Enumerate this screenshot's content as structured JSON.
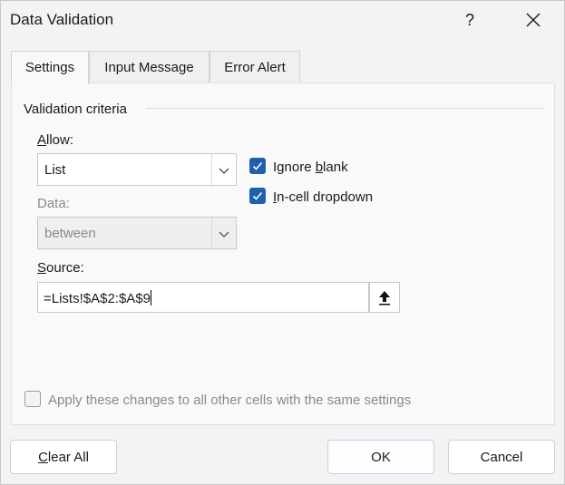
{
  "window": {
    "title": "Data Validation",
    "help_label": "?",
    "close_icon": "close-icon"
  },
  "tabs": [
    {
      "label": "Settings",
      "active": true
    },
    {
      "label": "Input Message",
      "active": false
    },
    {
      "label": "Error Alert",
      "active": false
    }
  ],
  "criteria": {
    "group_label": "Validation criteria",
    "allow": {
      "label_access": "A",
      "label_rest": "llow:",
      "value": "List"
    },
    "data": {
      "label": "Data:",
      "value": "between",
      "disabled": true
    },
    "ignore_blank": {
      "label_pre": "Ignore ",
      "label_access": "b",
      "label_post": "lank",
      "checked": true
    },
    "in_cell_dropdown": {
      "label_access": "I",
      "label_rest": "n-cell dropdown",
      "checked": true
    },
    "source": {
      "label_access": "S",
      "label_rest": "ource:",
      "value": "=Lists!$A$2:$A$9",
      "collapse_icon": "collapse-dialog-arrow-up-icon"
    }
  },
  "apply_all": {
    "label": "Apply these changes to all other cells with the same settings",
    "checked": false,
    "disabled": true
  },
  "buttons": {
    "clear_all_access": "C",
    "clear_all_rest": "lear All",
    "ok": "OK",
    "cancel": "Cancel"
  },
  "colors": {
    "accent": "#1f5fb0",
    "dialog_bg": "#f3f3f3",
    "panel_bg": "#f9f9f9"
  }
}
